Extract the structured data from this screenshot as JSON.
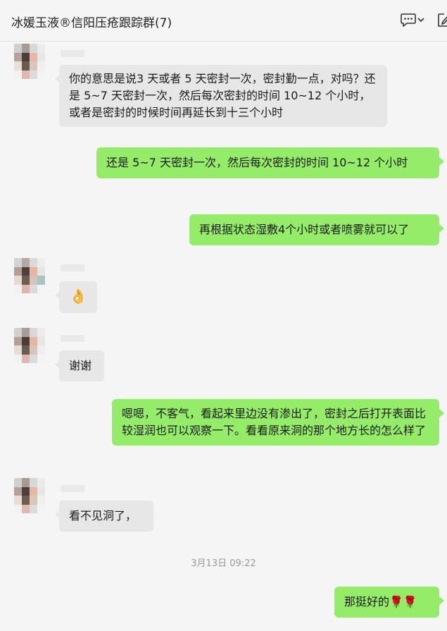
{
  "header": {
    "title": "冰媛玉液®信阳压疮跟踪群(7)",
    "icons": [
      "chat-icon",
      "chevron-down-icon",
      "edit-icon"
    ]
  },
  "messages": [
    {
      "side": "left",
      "text": "你的意思是说3 天或者 5 天密封一次，密封勤一点，对吗？还是 5~7 天密封一次，然后每次密封的时间 10~12 个小时，或者是密封的时候时间再延长到十三个小时"
    },
    {
      "side": "right",
      "text": "还是 5~7 天密封一次，然后每次密封的时间 10~12 个小时"
    },
    {
      "side": "right",
      "text": "再根据状态湿敷4个小时或者喷雾就可以了"
    },
    {
      "side": "left",
      "text": "👌",
      "is_emoji": true
    },
    {
      "side": "left",
      "text": "谢谢"
    },
    {
      "side": "right",
      "text": "嗯嗯，不客气，看起来里边没有渗出了，密封之后打开表面比较湿润也可以观察一下。看看原来洞的那个地方长的怎么样了"
    },
    {
      "side": "left",
      "text": "看不见洞了，"
    },
    {
      "side": "right",
      "text": "那挺好的🌹🌹"
    }
  ],
  "timestamp": "3月13日 09:22",
  "colors": {
    "background": "#f5f5f5",
    "incoming_bubble": "#e7e7e7",
    "outgoing_bubble": "#95ec69",
    "timestamp_text": "#9a9a9a"
  }
}
